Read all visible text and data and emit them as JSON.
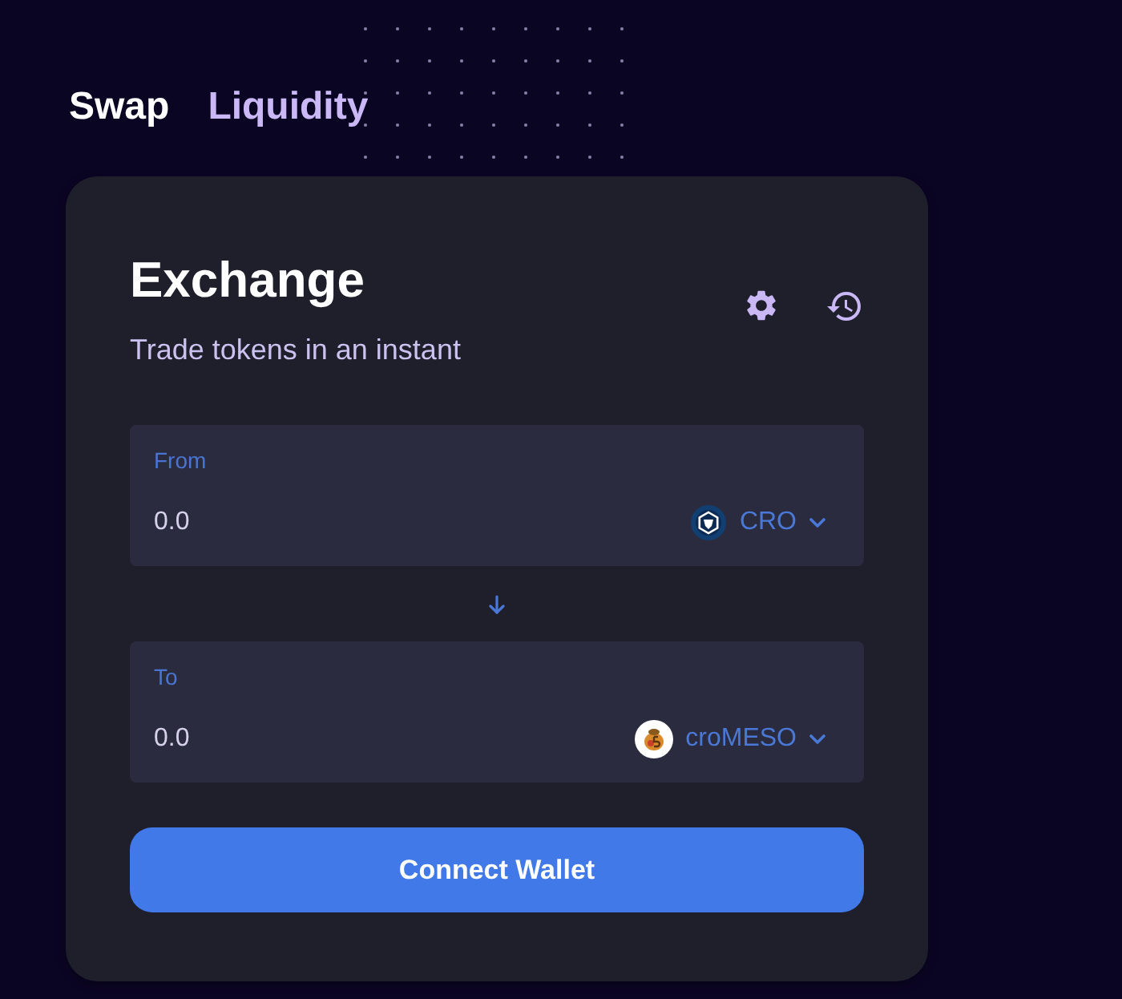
{
  "tabs": [
    {
      "label": "Swap",
      "selected": true
    },
    {
      "label": "Liquidity",
      "selected": false
    }
  ],
  "card": {
    "title": "Exchange",
    "subtitle": "Trade tokens in an instant"
  },
  "fields": [
    {
      "label": "From",
      "placeholder": "0.0",
      "token": {
        "symbol": "CRO",
        "kind": "cro"
      }
    },
    {
      "label": "To",
      "placeholder": "0.0",
      "token": {
        "symbol": "croMESO",
        "kind": "meso"
      }
    }
  ],
  "connect_button": {
    "label": "Connect Wallet"
  }
}
